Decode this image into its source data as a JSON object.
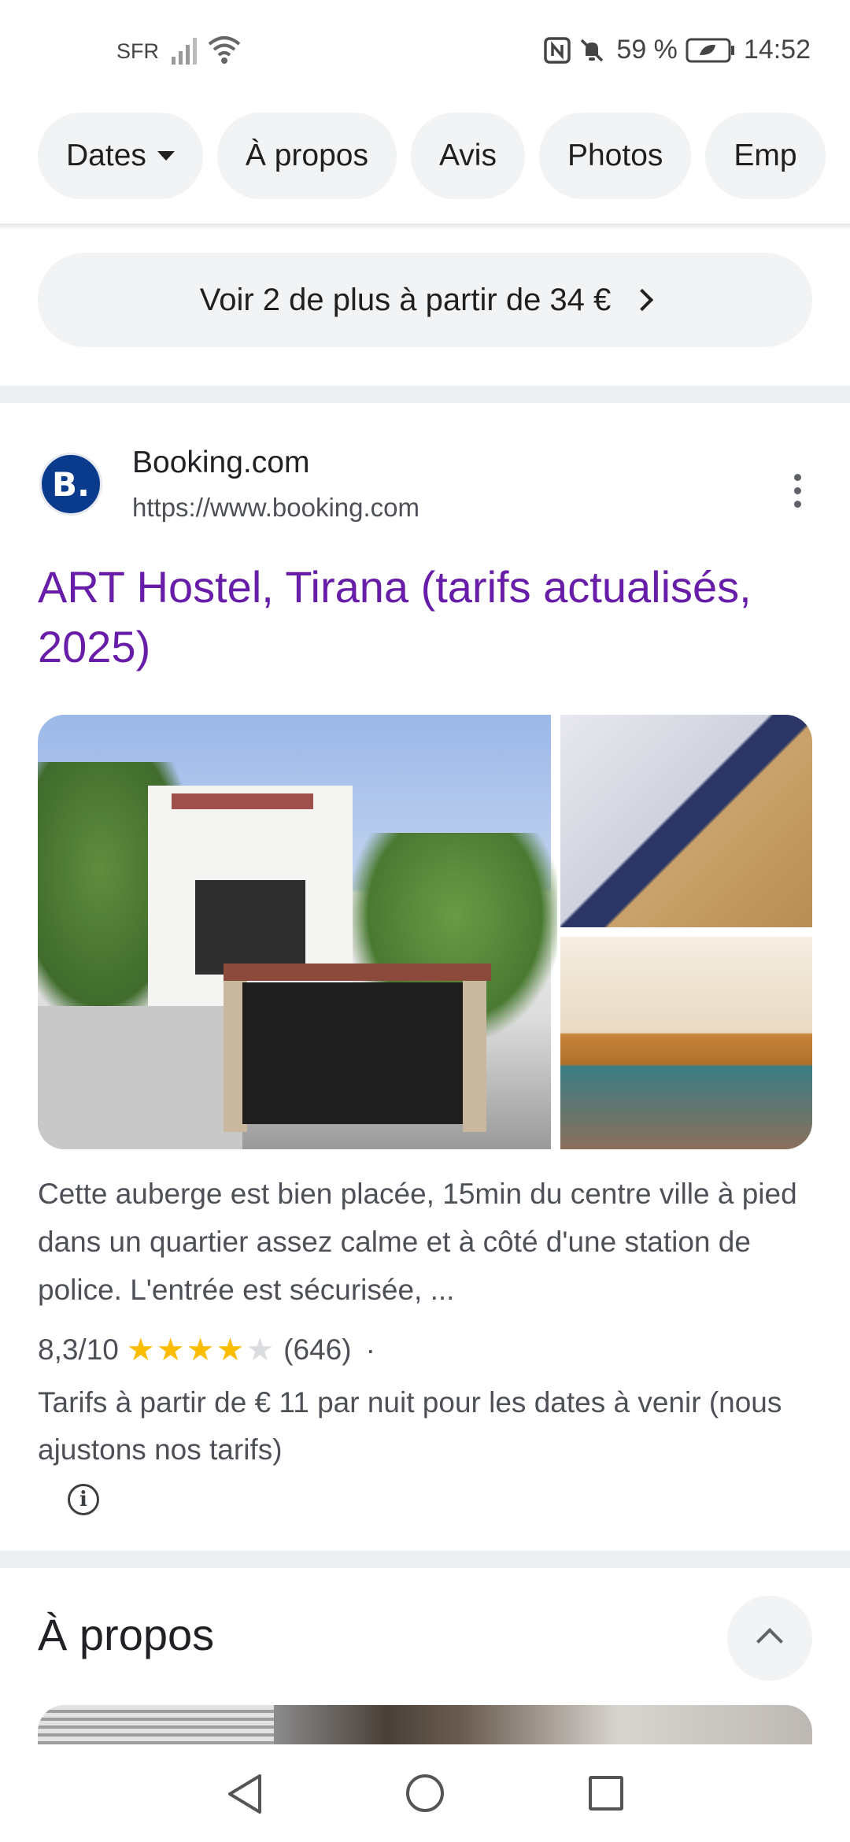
{
  "status_bar": {
    "carrier": "SFR",
    "battery_percent": "59 %",
    "time": "14:52",
    "icons": [
      "signal-icon",
      "wifi-icon",
      "nfc-icon",
      "mute-icon",
      "battery-icon"
    ]
  },
  "chips": [
    {
      "label": "Dates",
      "has_caret": true
    },
    {
      "label": "À propos"
    },
    {
      "label": "Avis"
    },
    {
      "label": "Photos"
    },
    {
      "label": "Emp"
    }
  ],
  "more_button": {
    "label": "Voir 2 de plus à partir de 34 €"
  },
  "result": {
    "source_logo": "B.",
    "source_name": "Booking.com",
    "source_url": "https://www.booking.com",
    "title": "ART Hostel, Tirana (tarifs actualisés, 2025)",
    "snippet": "Cette auberge est bien placée, 15min du centre ville à pied dans un quartier assez calme et à côté d'une station de police. L'entrée est sécurisée, ...",
    "rating": "8,3/10",
    "stars": 4,
    "review_count": "(646)",
    "separator": "·",
    "price_text": "Tarifs à partir de € 11 par nuit pour les dates à venir (nous ajustons nos tarifs)",
    "info_glyph": "i"
  },
  "about": {
    "title": "À propos"
  },
  "colors": {
    "link_title": "#681da8",
    "star": "#fbbc04",
    "chip_bg": "#f1f3f4",
    "logo_bg": "#0a3a8c"
  }
}
